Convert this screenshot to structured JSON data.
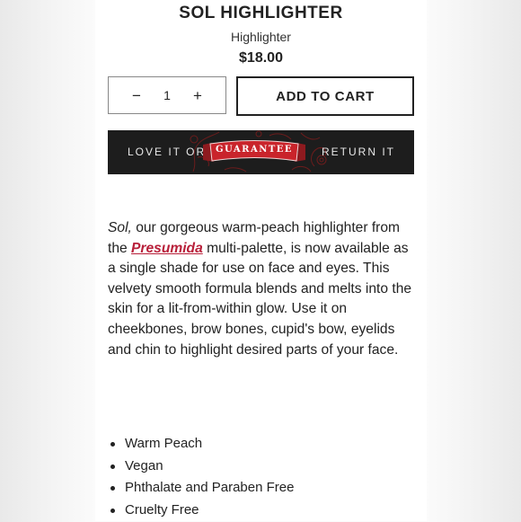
{
  "product": {
    "title": "SOL HIGHLIGHTER",
    "subtitle": "Highlighter",
    "price": "$18.00"
  },
  "quantity": {
    "minus": "−",
    "value": "1",
    "plus": "+"
  },
  "cart": {
    "add_label": "ADD TO CART"
  },
  "guarantee": {
    "left": "LOVE IT OR",
    "badge": "GUARANTEE",
    "right": "RETURN IT",
    "colors": {
      "background": "#1d1d1d",
      "ribbon": "#c9242b"
    }
  },
  "description": {
    "part1": "Sol,",
    "part2": " our gorgeous warm-peach highlighter from the ",
    "link": "Presumida",
    "part3": " multi-palette, is now available as a single shade for use on face and eyes. This velvety smooth formula blends and melts into the skin for a lit-from-within glow.  Use it on cheekbones, brow bones, cupid's bow, eyelids and chin to highlight desired parts of your face."
  },
  "features": [
    "Warm Peach",
    "Vegan",
    "Phthalate and Paraben Free",
    "Cruelty Free"
  ]
}
